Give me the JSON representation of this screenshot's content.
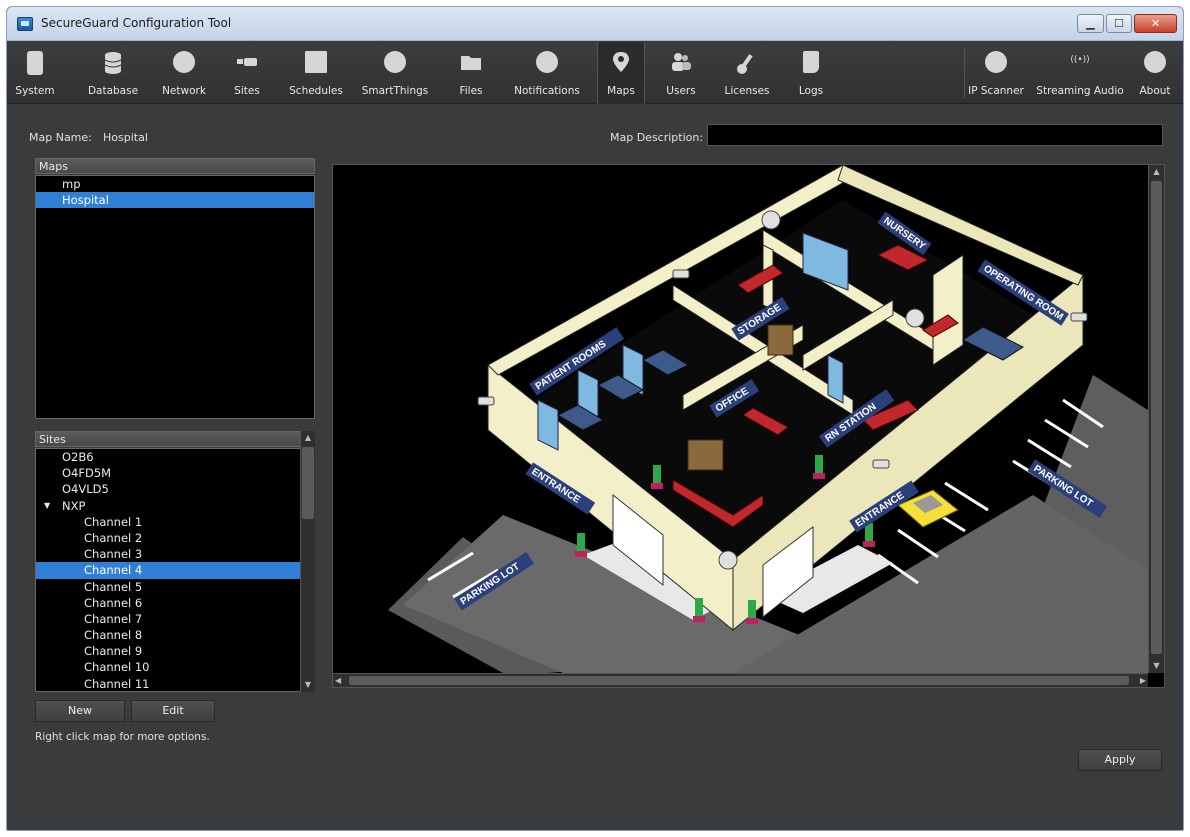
{
  "window": {
    "title": "SecureGuard Configuration Tool"
  },
  "toolbar": {
    "items": [
      {
        "label": "System",
        "icon": "server-icon"
      },
      {
        "label": "Database",
        "icon": "database-icon"
      },
      {
        "label": "Network",
        "icon": "globe-icon"
      },
      {
        "label": "Sites",
        "icon": "camera-icon"
      },
      {
        "label": "Schedules",
        "icon": "calendar-icon"
      },
      {
        "label": "SmartThings",
        "icon": "smartthings-icon"
      },
      {
        "label": "Files",
        "icon": "folder-icon"
      },
      {
        "label": "Notifications",
        "icon": "alert-icon"
      },
      {
        "label": "Maps",
        "icon": "map-pin-icon",
        "active": true
      },
      {
        "label": "Users",
        "icon": "users-icon"
      },
      {
        "label": "Licenses",
        "icon": "key-icon"
      },
      {
        "label": "Logs",
        "icon": "log-icon"
      }
    ],
    "right_items": [
      {
        "label": "IP Scanner",
        "icon": "ip-scanner-icon"
      },
      {
        "label": "Streaming Audio",
        "icon": "audio-stream-icon",
        "glyph": "((•))"
      },
      {
        "label": "About",
        "icon": "info-icon"
      }
    ]
  },
  "map_name": {
    "label": "Map Name:",
    "value": "Hospital"
  },
  "map_description": {
    "label": "Map Description:",
    "value": ""
  },
  "maps_panel": {
    "title": "Maps",
    "items": [
      "mp",
      "Hospital"
    ],
    "selected": "Hospital"
  },
  "sites_panel": {
    "title": "Sites",
    "items": [
      {
        "label": "O2B6",
        "indent": 0
      },
      {
        "label": "O4FD5M",
        "indent": 0
      },
      {
        "label": "O4VLD5",
        "indent": 0
      },
      {
        "label": "NXP",
        "indent": 0,
        "expanded": true
      },
      {
        "label": "Channel 1",
        "indent": 1
      },
      {
        "label": "Channel 2",
        "indent": 1
      },
      {
        "label": "Channel 3",
        "indent": 1
      },
      {
        "label": "Channel 4",
        "indent": 1,
        "selected": true
      },
      {
        "label": "Channel 5",
        "indent": 1
      },
      {
        "label": "Channel 6",
        "indent": 1
      },
      {
        "label": "Channel 7",
        "indent": 1
      },
      {
        "label": "Channel 8",
        "indent": 1
      },
      {
        "label": "Channel 9",
        "indent": 1
      },
      {
        "label": "Channel 10",
        "indent": 1
      },
      {
        "label": "Channel 11",
        "indent": 1
      }
    ]
  },
  "buttons": {
    "new": "New",
    "edit": "Edit",
    "apply": "Apply"
  },
  "hint": "Right click map for more options.",
  "map_labels": {
    "nursery": "NURSERY",
    "operating_room": "OPERATING ROOM",
    "storage": "STORAGE",
    "patient_rooms": "PATIENT ROOMS",
    "office": "OFFICE",
    "rn_station": "RN STATION",
    "entrance_left": "ENTRANCE",
    "entrance_right": "ENTRANCE",
    "parking_lot_left": "PARKING LOT",
    "parking_lot_right": "PARKING LOT"
  },
  "colors": {
    "selection": "#2f7fd6",
    "wall": "#f3efc8",
    "floor": "#0a0a0a",
    "furniture_red": "#c0282d",
    "sign_blue": "#2b3f7a",
    "car_yellow": "#f5e03a"
  }
}
